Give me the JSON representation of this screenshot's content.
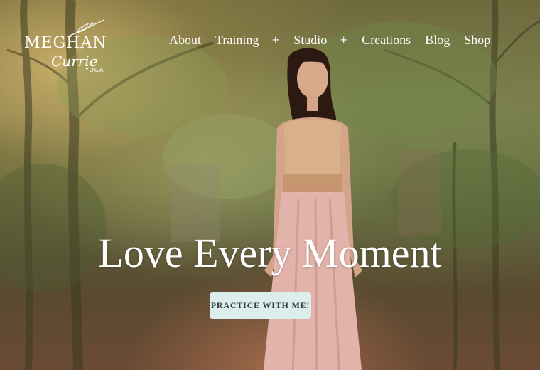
{
  "brand": {
    "name_line1": "MEGHAN",
    "name_line2": "Currie",
    "name_line3": "YOGA",
    "leaf_icon": "feather-icon"
  },
  "nav": {
    "items": [
      {
        "label": "About"
      },
      {
        "label": "Training",
        "submenu": "+"
      },
      {
        "label": "Studio",
        "submenu": "+"
      },
      {
        "label": "Creations"
      },
      {
        "label": "Blog"
      },
      {
        "label": "Shop"
      }
    ]
  },
  "hero": {
    "headline": "Love Every Moment",
    "cta_label": "PRACTICE WITH ME!",
    "cta_color": "#dbeeeb",
    "text_color": "#ffffff"
  }
}
